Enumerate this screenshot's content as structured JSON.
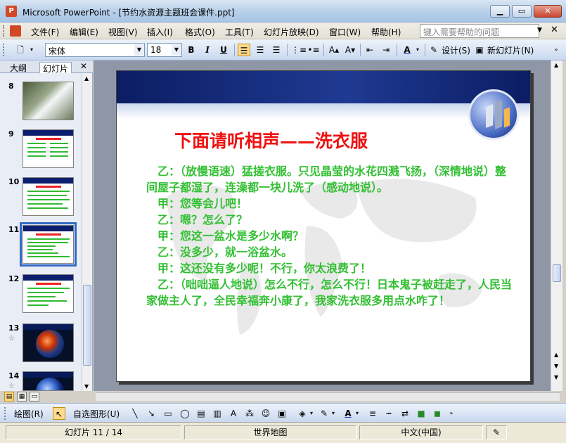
{
  "window": {
    "title": "Microsoft PowerPoint - [节约水资源主题班会课件.ppt]",
    "app_icon": "P"
  },
  "menu": {
    "items": [
      "文件(F)",
      "编辑(E)",
      "视图(V)",
      "插入(I)",
      "格式(O)",
      "工具(T)",
      "幻灯片放映(D)",
      "窗口(W)",
      "帮助(H)"
    ],
    "help_placeholder": "键入需要帮助的问题"
  },
  "toolbar": {
    "font": "宋体",
    "size": "18",
    "bold": "B",
    "italic": "I",
    "underline": "U",
    "design_label": "设计(S)",
    "new_slide_label": "新幻灯片(N)"
  },
  "left_panel": {
    "tab_outline": "大纲",
    "tab_slides": "幻灯片",
    "thumbnails": [
      {
        "num": "8",
        "kind": "photo"
      },
      {
        "num": "9",
        "kind": "text"
      },
      {
        "num": "10",
        "kind": "text"
      },
      {
        "num": "11",
        "kind": "text",
        "selected": true
      },
      {
        "num": "12",
        "kind": "text"
      },
      {
        "num": "13",
        "kind": "globe",
        "star": "☆"
      },
      {
        "num": "14",
        "kind": "globe",
        "star": "☆"
      }
    ]
  },
  "slide": {
    "title": "下面请听相声——洗衣服",
    "lines": [
      "　乙：（放慢语速）猛搓衣服。只见晶莹的水花四溅飞扬，（深情地说）整间屋子都湿了，连澡都一块儿洗了（感动地说）。",
      "　甲：您等会儿吧！",
      "　乙：嗯？怎么了？",
      "　甲：您这一盆水是多少水啊？",
      "　乙：没多少，就一浴盆水。",
      "　甲：这还没有多少呢！不行，你太浪费了！",
      "　乙：（咄咄逼人地说）怎么不行，怎么不行！日本鬼子被赶走了，人民当家做主人了，全民幸福奔小康了，我家洗衣服多用点水咋了！"
    ]
  },
  "drawbar": {
    "draw_label": "绘图(R)",
    "autoshapes_label": "自选图形(U)"
  },
  "status": {
    "slide_info": "幻灯片 11 / 14",
    "design": "世界地图",
    "language": "中文(中国)"
  },
  "colors": {
    "title_red": "#ee1111",
    "body_green": "#33c033",
    "slide_band": "#0b1d63"
  }
}
